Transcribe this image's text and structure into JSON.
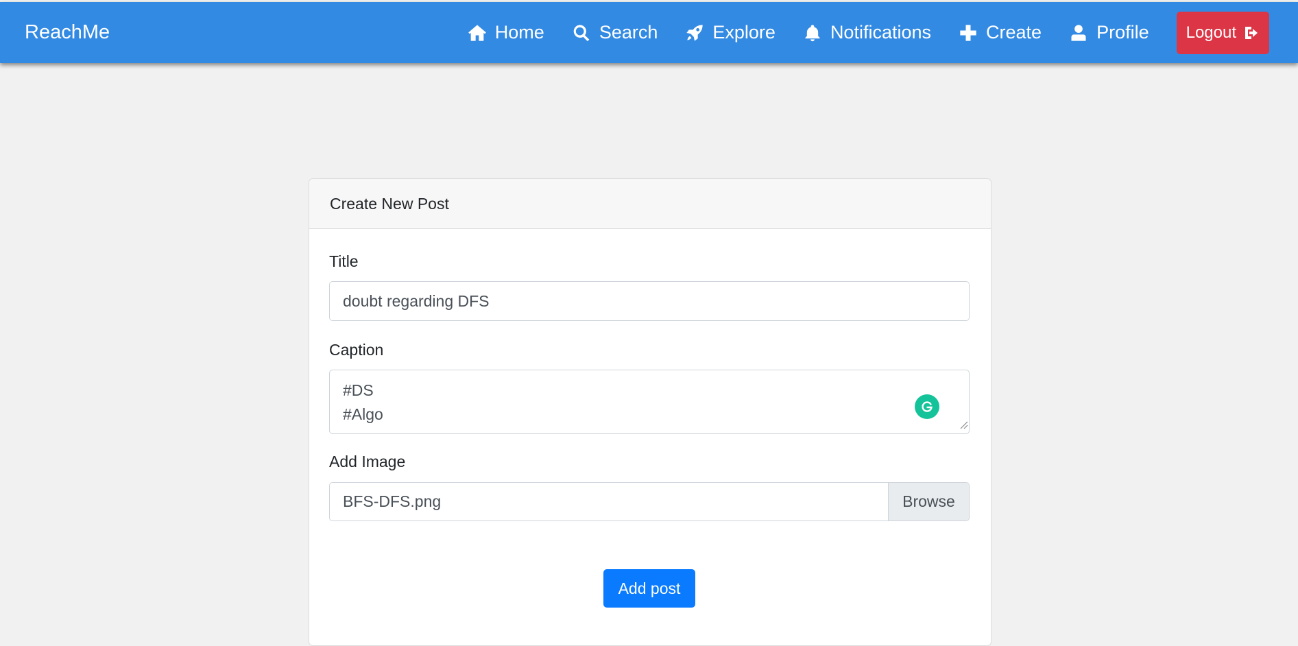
{
  "navbar": {
    "brand": "ReachMe",
    "background": "#338ae3",
    "items": [
      {
        "label": "Home",
        "icon": "home-icon"
      },
      {
        "label": "Search",
        "icon": "search-icon"
      },
      {
        "label": "Explore",
        "icon": "rocket-icon"
      },
      {
        "label": "Notifications",
        "icon": "bell-icon"
      },
      {
        "label": "Create",
        "icon": "plus-icon"
      },
      {
        "label": "Profile",
        "icon": "user-icon"
      }
    ],
    "logout": {
      "label": "Logout",
      "icon": "sign-out-icon",
      "color": "#dc3545"
    }
  },
  "form": {
    "heading": "Create New Post",
    "title_label": "Title",
    "title_value": "doubt regarding DFS",
    "caption_label": "Caption",
    "caption_value": "#DS\n#Algo",
    "image_label": "Add Image",
    "image_file": "BFS-DFS.png",
    "browse_label": "Browse",
    "submit_label": "Add post",
    "submit_color": "#0a7bff"
  },
  "extensions": {
    "grammarly_icon": "grammarly-icon"
  }
}
